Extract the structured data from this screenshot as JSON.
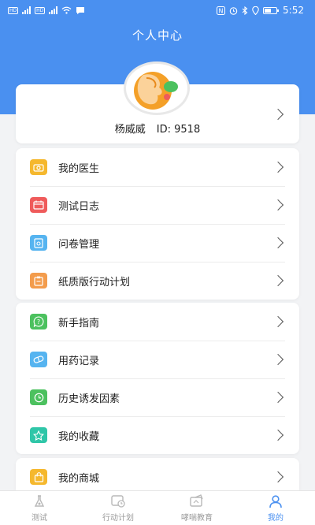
{
  "colors": {
    "primary": "#4a90f0",
    "background": "#f2f3f5",
    "tab_inactive": "#999999"
  },
  "status_bar": {
    "time": "5:52",
    "left_tags": [
      "HD",
      "HD"
    ],
    "icons": [
      "nfc-icon",
      "alarm-icon",
      "bluetooth-icon",
      "location-icon",
      "battery-icon"
    ]
  },
  "page": {
    "title": "个人中心"
  },
  "profile": {
    "name": "杨威威",
    "id_text": "ID: 9518"
  },
  "menu_groups": [
    [
      {
        "label": "我的医生",
        "icon": "doctor-icon",
        "color": "#f5b82e"
      },
      {
        "label": "测试日志",
        "icon": "calendar-icon",
        "color": "#ef5b5b"
      },
      {
        "label": "问卷管理",
        "icon": "questionnaire-icon",
        "color": "#56b4f0"
      },
      {
        "label": "纸质版行动计划",
        "icon": "clipboard-icon",
        "color": "#f39c4c"
      }
    ],
    [
      {
        "label": "新手指南",
        "icon": "question-icon",
        "color": "#4cc15f"
      },
      {
        "label": "用药记录",
        "icon": "pill-icon",
        "color": "#56b4f0"
      },
      {
        "label": "历史诱发因素",
        "icon": "history-icon",
        "color": "#4cc15f"
      },
      {
        "label": "我的收藏",
        "icon": "star-icon",
        "color": "#2fc6a8"
      }
    ],
    [
      {
        "label": "我的商城",
        "icon": "shopping-bag-icon",
        "color": "#f5b82e"
      }
    ]
  ],
  "tabs": [
    {
      "label": "测试",
      "icon": "test-icon",
      "active": false
    },
    {
      "label": "行动计划",
      "icon": "plan-icon",
      "active": false
    },
    {
      "label": "哮喘教育",
      "icon": "education-icon",
      "active": false
    },
    {
      "label": "我的",
      "icon": "user-icon",
      "active": true
    }
  ]
}
